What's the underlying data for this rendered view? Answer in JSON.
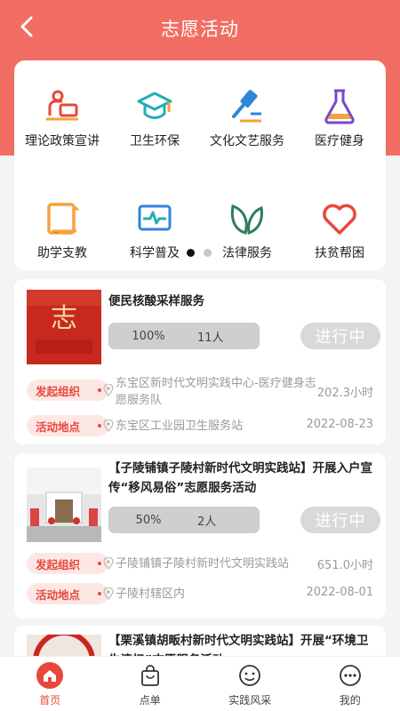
{
  "header": {
    "title": "志愿活动"
  },
  "categories": [
    {
      "label": "理论政策宣讲",
      "icon": "lecturer-icon"
    },
    {
      "label": "卫生环保",
      "icon": "graduation-cap-icon"
    },
    {
      "label": "文化文艺服务",
      "icon": "gavel-icon"
    },
    {
      "label": "医疗健身",
      "icon": "flask-icon"
    },
    {
      "label": "助学支教",
      "icon": "book-icon"
    },
    {
      "label": "科学普及",
      "icon": "pulse-monitor-icon"
    },
    {
      "label": "法律服务",
      "icon": "leaf-icon"
    },
    {
      "label": "扶贫帮困",
      "icon": "heart-icon"
    }
  ],
  "pager": {
    "pages": 2,
    "active": 1
  },
  "activities": [
    {
      "title": "便民核酸采样服务",
      "progress": "100%",
      "people": "11人",
      "status": "进行中",
      "organizer_label": "发起组织",
      "organizer": "东宝区新时代文明实践中心-医疗健身志愿服务队",
      "hours": "202.3小时",
      "location_label": "活动地点",
      "location": "东宝区工业园卫生服务站",
      "date": "2022-08-23"
    },
    {
      "title": "【子陵铺镇子陵村新时代文明实践站】开展入户宣传“移风易俗”志愿服务活动",
      "progress": "50%",
      "people": "2人",
      "status": "进行中",
      "organizer_label": "发起组织",
      "organizer": "子陵铺镇子陵村新时代文明实践站",
      "hours": "651.0小时",
      "location_label": "活动地点",
      "location": "子陵村辖区内",
      "date": "2022-08-01"
    },
    {
      "title": "【栗溪镇胡畈村新时代文明实践站】开展“环境卫生清扫”志愿服务活动"
    }
  ],
  "tabbar": [
    {
      "label": "首页",
      "icon": "home-icon",
      "active": true
    },
    {
      "label": "点单",
      "icon": "shopping-bag-icon"
    },
    {
      "label": "实践风采",
      "icon": "smile-icon"
    },
    {
      "label": "我的",
      "icon": "more-icon"
    }
  ],
  "colors": {
    "brand": "#f26d63",
    "accent": "#e8483c",
    "tag_bg": "#fde7e5",
    "status_bg": "#d9d9d9"
  }
}
